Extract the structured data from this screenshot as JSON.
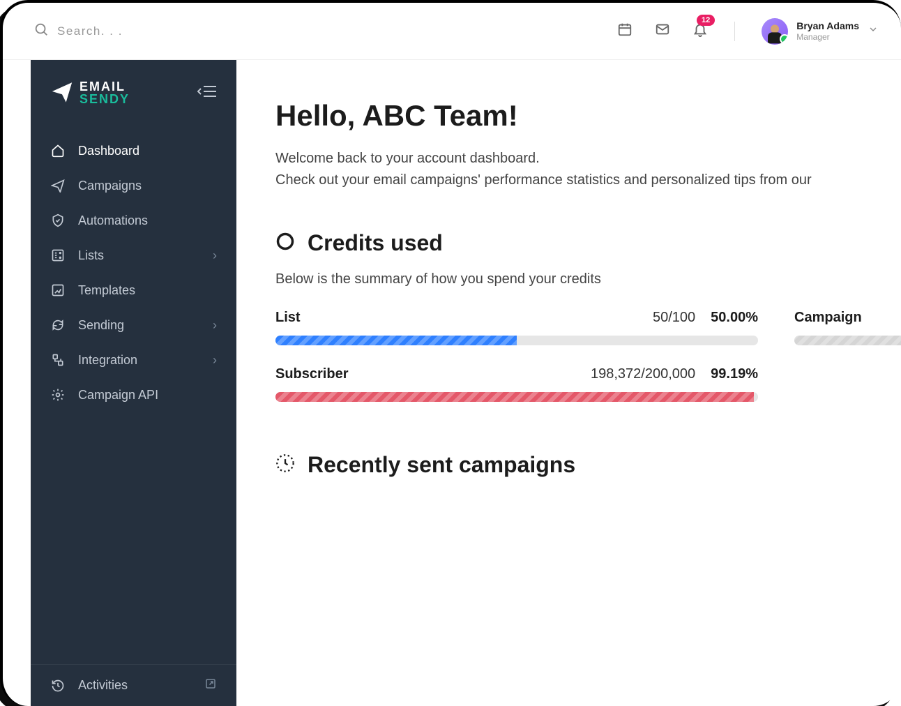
{
  "topbar": {
    "search_placeholder": "Search. . .",
    "notification_count": "12",
    "user": {
      "name": "Bryan Adams",
      "role": "Manager"
    }
  },
  "logo": {
    "line1": "EMAIL",
    "line2": "SENDY"
  },
  "sidebar": {
    "items": [
      {
        "label": "Dashboard",
        "icon": "home",
        "active": true
      },
      {
        "label": "Campaigns",
        "icon": "send"
      },
      {
        "label": "Automations",
        "icon": "shield"
      },
      {
        "label": "Lists",
        "icon": "list",
        "expandable": true
      },
      {
        "label": "Templates",
        "icon": "template"
      },
      {
        "label": "Sending",
        "icon": "refresh",
        "expandable": true
      },
      {
        "label": "Integration",
        "icon": "plug",
        "expandable": true
      },
      {
        "label": "Campaign API",
        "icon": "gear"
      }
    ],
    "footer": {
      "label": "Activities"
    }
  },
  "main": {
    "title": "Hello, ABC Team!",
    "welcome_line1": "Welcome back to your account dashboard.",
    "welcome_line2": "Check out your email campaigns' performance statistics and personalized tips from our",
    "credits": {
      "title": "Credits used",
      "subtitle": "Below is the summary of how you spend your credits",
      "items": [
        {
          "label": "List",
          "nums": "50/100",
          "pct": "50.00%",
          "fill": 50,
          "color": "blue"
        },
        {
          "label": "Subscriber",
          "nums": "198,372/200,000",
          "pct": "99.19%",
          "fill": 99.19,
          "color": "red"
        }
      ],
      "secondary": {
        "label": "Campaign"
      }
    },
    "recent": {
      "title": "Recently sent campaigns"
    }
  },
  "chart_data": {
    "type": "bar",
    "title": "Credits used",
    "series": [
      {
        "name": "List",
        "value": 50,
        "max": 100,
        "pct": 50.0
      },
      {
        "name": "Subscriber",
        "value": 198372,
        "max": 200000,
        "pct": 99.19
      }
    ]
  }
}
